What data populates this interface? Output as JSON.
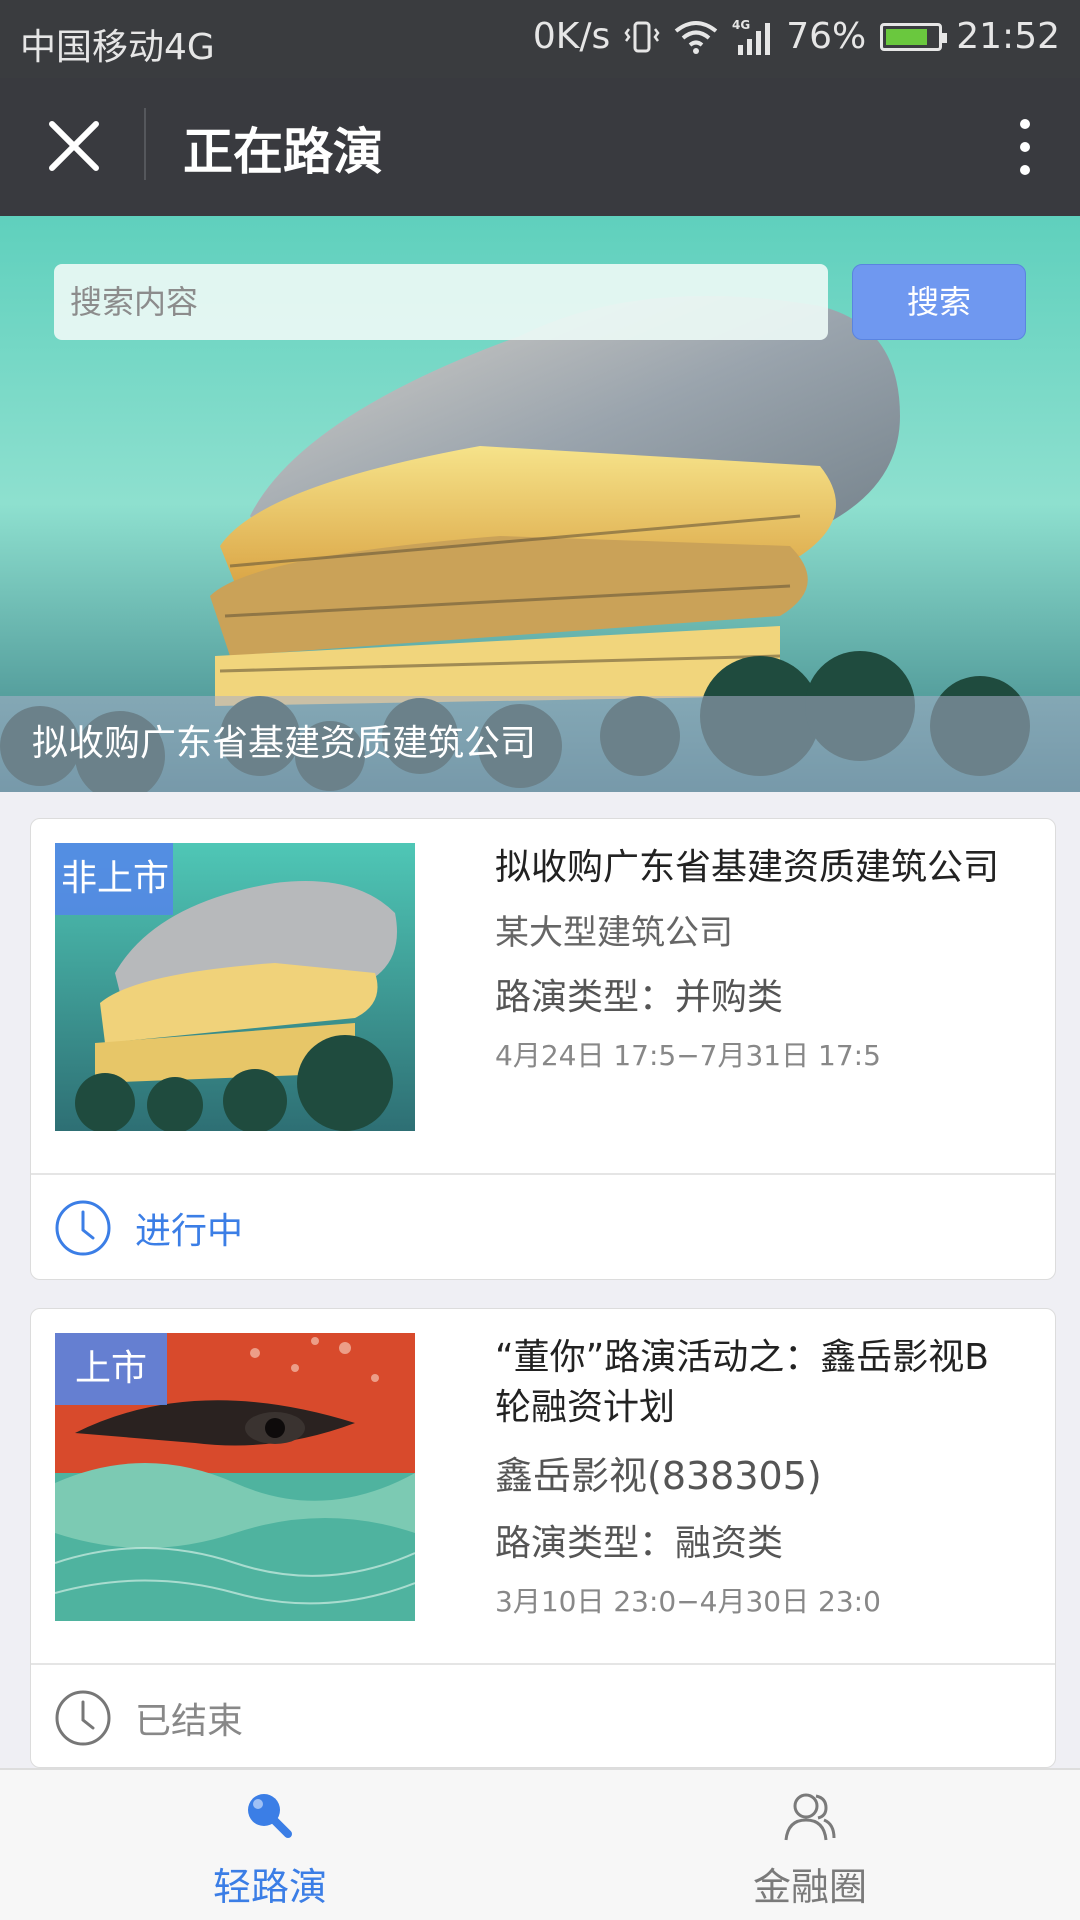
{
  "statusbar": {
    "carrier": "中国移动4G",
    "net_speed": "0K/s",
    "battery": "76%",
    "time": "21:52"
  },
  "navbar": {
    "title": "正在路演"
  },
  "search": {
    "placeholder": "搜索内容",
    "button_label": "搜索"
  },
  "banner": {
    "caption": "拟收购广东省基建资质建筑公司"
  },
  "cards": [
    {
      "tag": "非上市",
      "title": "拟收购广东省基建资质建筑公司",
      "company": "某大型建筑公司",
      "roadshow_type": "路演类型：并购类",
      "dates": "4月24日 17:5−7月31日 17:5",
      "status": "进行中",
      "status_color": "#3b7ee6"
    },
    {
      "tag": "上市",
      "title": "“董你”路演活动之：鑫岳影视B轮融资计划",
      "company": "鑫岳影视(838305)",
      "roadshow_type": "路演类型：融资类",
      "dates": "3月10日 23:0−4月30日 23:0",
      "status": "已结束",
      "status_color": "#888888"
    }
  ],
  "tabbar": {
    "tabs": [
      {
        "label": "轻路演",
        "icon": "roadshow-icon",
        "active": true,
        "color": "#3b7ee6"
      },
      {
        "label": "金融圈",
        "icon": "user-group-icon",
        "active": false,
        "color": "#7a7a7a"
      }
    ]
  }
}
